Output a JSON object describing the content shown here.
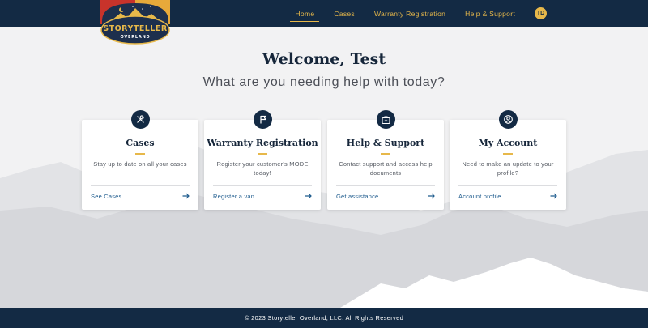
{
  "brand": {
    "logo_top": "STORYTELLER",
    "logo_bottom": "OVERLAND"
  },
  "nav": {
    "items": [
      {
        "label": "Home",
        "active": true
      },
      {
        "label": "Cases",
        "active": false
      },
      {
        "label": "Warranty Registration",
        "active": false
      },
      {
        "label": "Help & Support",
        "active": false
      }
    ],
    "avatar_initials": "TD"
  },
  "hero": {
    "title": "Welcome, Test",
    "subtitle": "What are you needing help with today?"
  },
  "cards": [
    {
      "icon": "tools-icon",
      "title": "Cases",
      "description": "Stay up to date on all your cases",
      "link": "See Cases"
    },
    {
      "icon": "flag-icon",
      "title": "Warranty Registration",
      "description": "Register your customer's MODE today!",
      "link": "Register a van"
    },
    {
      "icon": "first-aid-kit-icon",
      "title": "Help & Support",
      "description": "Contact support and access help documents",
      "link": "Get assistance"
    },
    {
      "icon": "user-circle-icon",
      "title": "My Account",
      "description": "Need to make an update to your profile?",
      "link": "Account profile"
    }
  ],
  "footer": {
    "text": "© 2023 Storyteller Overland, LLC. All Rights Reserved"
  },
  "colors": {
    "navy": "#132a44",
    "gold": "#e7b84a",
    "link_blue": "#1f5c8e",
    "background": "#f2f2f3"
  }
}
